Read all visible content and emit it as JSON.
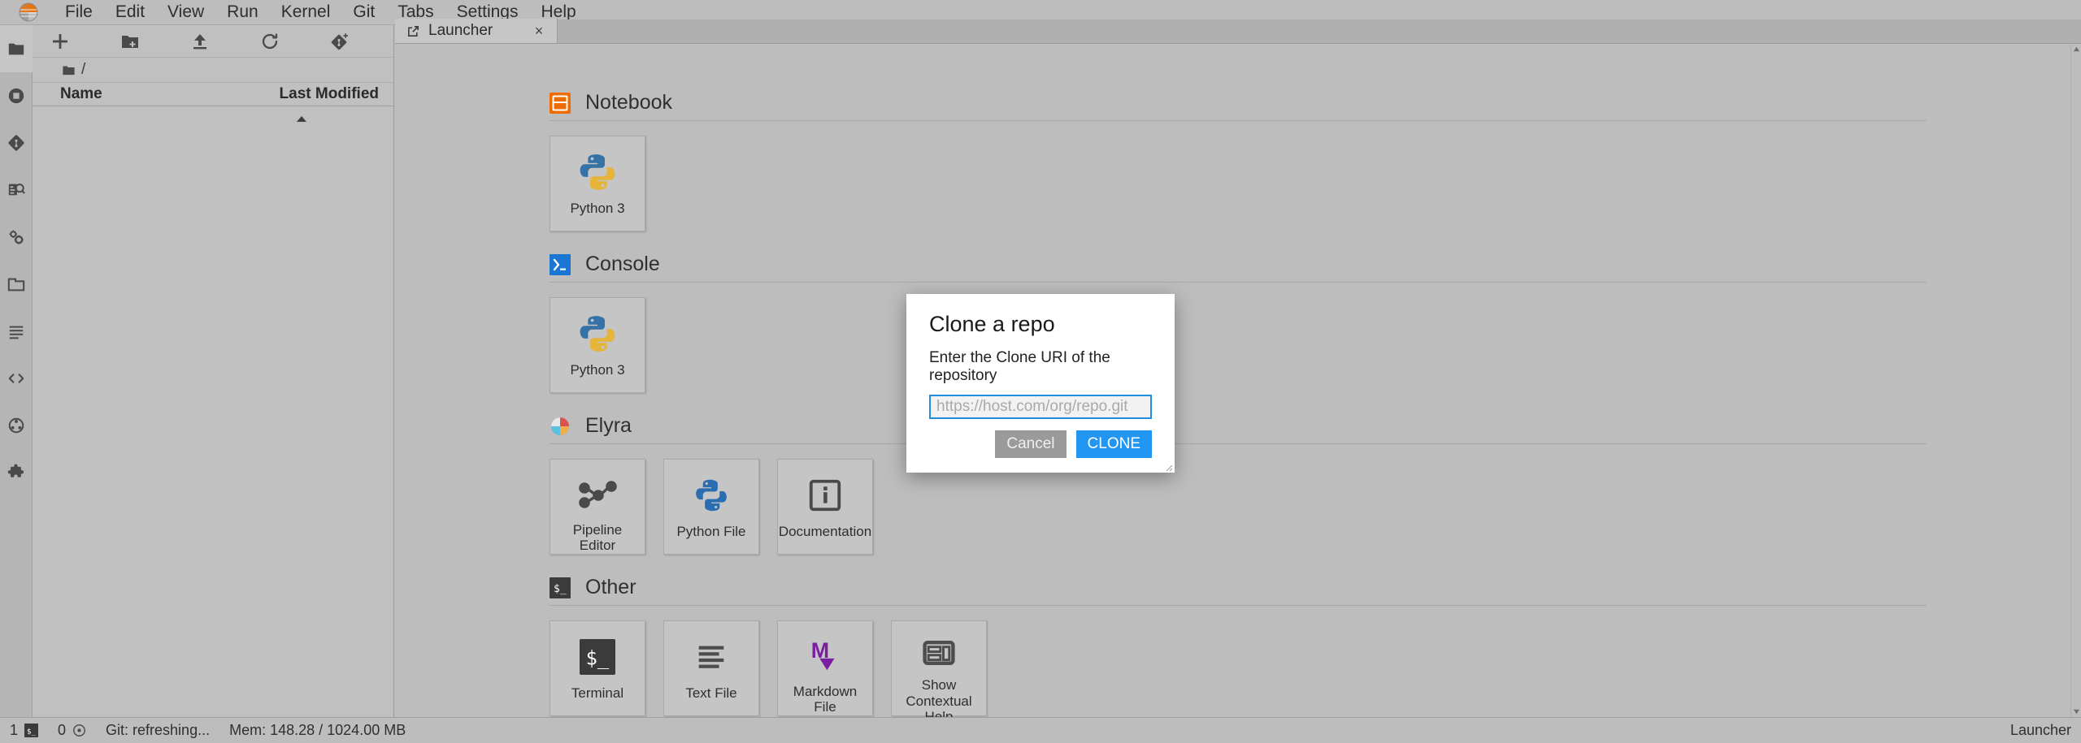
{
  "app": {
    "title": "JupyterLab",
    "logo_icon": "jupyter-logo-icon"
  },
  "menubar": {
    "items": [
      {
        "label": "File"
      },
      {
        "label": "Edit"
      },
      {
        "label": "View"
      },
      {
        "label": "Run"
      },
      {
        "label": "Kernel"
      },
      {
        "label": "Git"
      },
      {
        "label": "Tabs"
      },
      {
        "label": "Settings"
      },
      {
        "label": "Help"
      }
    ]
  },
  "activitybar": {
    "items": [
      {
        "name": "file-browser-icon",
        "title": "File Browser",
        "active": true
      },
      {
        "name": "running-terminals-icon",
        "title": "Running Terminals and Kernels",
        "active": false
      },
      {
        "name": "git-icon",
        "title": "Git",
        "active": false
      },
      {
        "name": "debugger-icon",
        "title": "Debugger",
        "active": false
      },
      {
        "name": "property-inspector-icon",
        "title": "Property Inspector",
        "active": false
      },
      {
        "name": "open-tabs-icon",
        "title": "Open Tabs",
        "active": false
      },
      {
        "name": "table-of-contents-icon",
        "title": "Table of Contents",
        "active": false
      },
      {
        "name": "code-snippets-icon",
        "title": "Code Snippets",
        "active": false
      },
      {
        "name": "runtimes-icon",
        "title": "Runtimes",
        "active": false
      },
      {
        "name": "extension-manager-icon",
        "title": "Extension Manager",
        "active": false
      }
    ]
  },
  "filebrowser": {
    "toolbar": [
      {
        "name": "new-launcher-button",
        "title": "New Launcher",
        "icon": "plus-icon"
      },
      {
        "name": "new-folder-button",
        "title": "New Folder",
        "icon": "new-folder-icon"
      },
      {
        "name": "upload-button",
        "title": "Upload Files",
        "icon": "upload-icon"
      },
      {
        "name": "refresh-button",
        "title": "Refresh File List",
        "icon": "refresh-icon"
      },
      {
        "name": "git-clone-button",
        "title": "Clone a Repository",
        "icon": "git-clone-icon"
      }
    ],
    "breadcrumb": "/",
    "columns": {
      "name": "Name",
      "last_modified": "Last Modified"
    },
    "sort_column": "Name",
    "sort_direction": "ascending",
    "files": []
  },
  "dock": {
    "tabs": [
      {
        "label": "Launcher",
        "icon": "launcher-icon",
        "active": true,
        "close": "×"
      }
    ]
  },
  "launcher": {
    "sections": [
      {
        "title": "Notebook",
        "icon": "notebook-icon",
        "cards": [
          {
            "label": "Python 3",
            "icon": "python-icon"
          }
        ]
      },
      {
        "title": "Console",
        "icon": "console-icon",
        "cards": [
          {
            "label": "Python 3",
            "icon": "python-icon"
          }
        ]
      },
      {
        "title": "Elyra",
        "icon": "elyra-icon",
        "cards": [
          {
            "label": "Pipeline Editor",
            "icon": "pipeline-editor-icon"
          },
          {
            "label": "Python File",
            "icon": "python-icon"
          },
          {
            "label": "Documentation",
            "icon": "documentation-icon"
          }
        ]
      },
      {
        "title": "Other",
        "icon": "other-icon",
        "cards": [
          {
            "label": "Terminal",
            "icon": "terminal-icon"
          },
          {
            "label": "Text File",
            "icon": "text-file-icon"
          },
          {
            "label": "Markdown File",
            "icon": "markdown-icon"
          },
          {
            "label": "Show Contextual Help",
            "icon": "contextual-help-icon"
          }
        ]
      }
    ]
  },
  "dialog": {
    "title": "Clone a repo",
    "body_label": "Enter the Clone URI of the repository",
    "input_value": "",
    "input_placeholder": "https://host.com/org/repo.git",
    "cancel_label": "Cancel",
    "clone_label": "CLONE",
    "accent_color": "#2196f3",
    "cancel_color": "#9a9a9a"
  },
  "statusbar": {
    "terminals_count": "1",
    "kernels_count": "0",
    "git_status": "Git: refreshing...",
    "memory": "Mem: 148.28 / 1024.00 MB",
    "active_item": "Launcher"
  }
}
